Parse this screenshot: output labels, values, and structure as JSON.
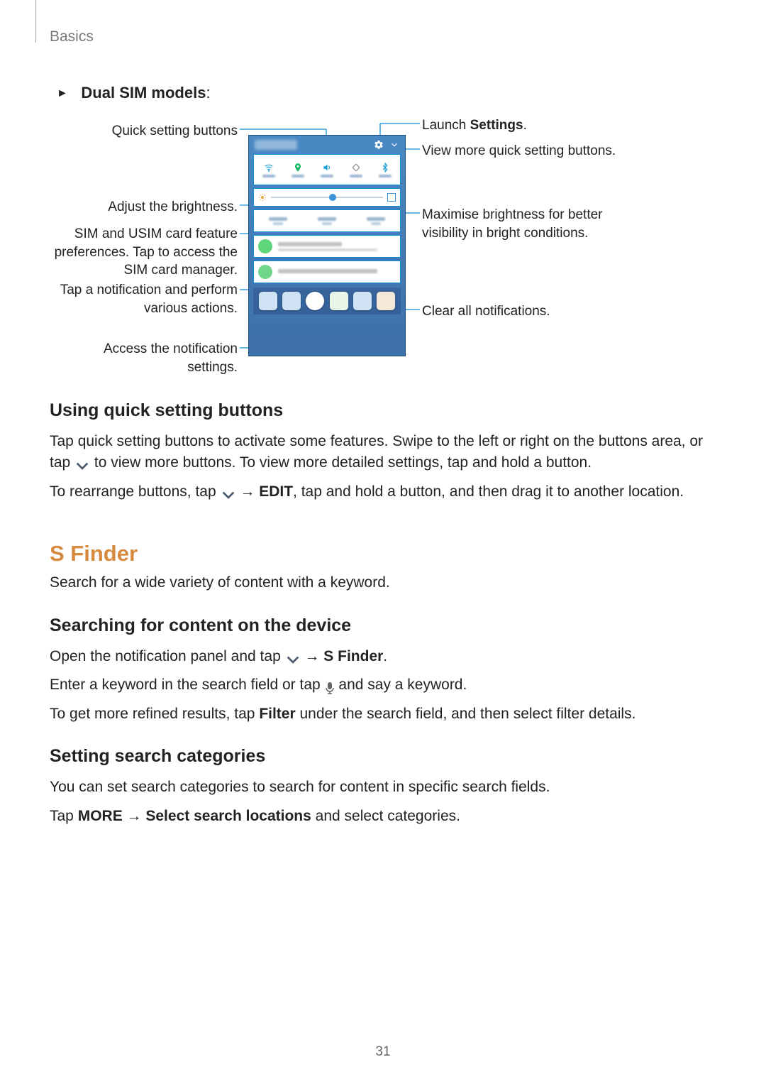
{
  "page": {
    "section_label": "Basics",
    "number": "31"
  },
  "bullet": {
    "label_prefix": "Dual SIM models",
    "label_suffix": ":"
  },
  "diagram": {
    "left": {
      "quick_settings": "Quick setting buttons",
      "brightness": "Adjust the brightness.",
      "sim": "SIM and USIM card feature preferences. Tap to access the SIM card manager.",
      "notification": "Tap a notification and perform various actions.",
      "notif_settings": "Access the notification settings."
    },
    "right": {
      "settings_prefix": "Launch ",
      "settings_bold": "Settings",
      "settings_suffix": ".",
      "more": "View more quick setting buttons.",
      "max_bright": "Maximise brightness for better visibility in bright conditions.",
      "clear": "Clear all notifications."
    }
  },
  "sections": {
    "qs_head": "Using quick setting buttons",
    "qs_p1_a": "Tap quick setting buttons to activate some features. Swipe to the left or right on the buttons area, or tap ",
    "qs_p1_b": " to view more buttons. To view more detailed settings, tap and hold a button.",
    "qs_p2_a": "To rearrange buttons, tap ",
    "qs_p2_arrow": " → ",
    "qs_p2_edit": "EDIT",
    "qs_p2_b": ", tap and hold a button, and then drag it to another location.",
    "sfinder_head": "S Finder",
    "sfinder_p": "Search for a wide variety of content with a keyword.",
    "search_head": "Searching for content on the device",
    "search_p1_a": "Open the notification panel and tap ",
    "search_p1_arrow": " → ",
    "search_p1_b": "S Finder",
    "search_p1_c": ".",
    "search_p2_a": "Enter a keyword in the search field or tap ",
    "search_p2_b": " and say a keyword.",
    "search_p3_a": "To get more refined results, tap ",
    "search_p3_filter": "Filter",
    "search_p3_b": " under the search field, and then select filter details.",
    "cat_head": "Setting search categories",
    "cat_p1": "You can set search categories to search for content in specific search fields.",
    "cat_p2_a": "Tap ",
    "cat_p2_more": "MORE",
    "cat_p2_arrow": " → ",
    "cat_p2_sel": "Select search locations",
    "cat_p2_b": " and select categories."
  }
}
